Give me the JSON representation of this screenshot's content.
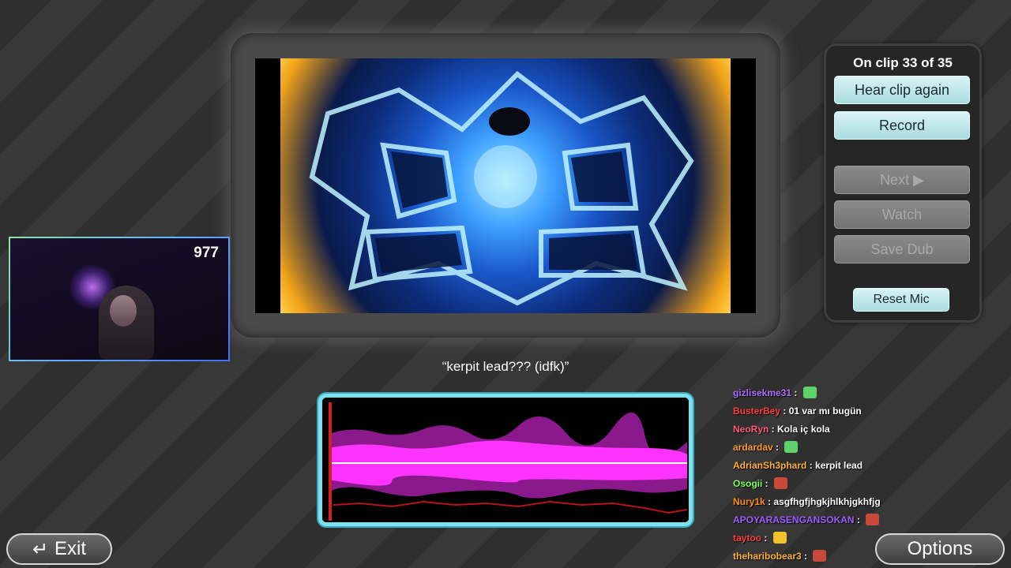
{
  "panel": {
    "clip_status": "On clip 33 of 35",
    "hear_clip_again": "Hear clip again",
    "record": "Record",
    "next": "Next ▶",
    "watch": "Watch",
    "save_dub": "Save Dub",
    "reset_mic": "Reset Mic"
  },
  "webcam": {
    "count": "977"
  },
  "subtitle": "“kerpit lead??? (idfk)”",
  "chat": [
    {
      "user": "gizlisekme31",
      "color": "#b06cff",
      "message": "",
      "emote": "frog"
    },
    {
      "user": "BusterBey",
      "color": "#ff3b3b",
      "message": "01 var mı bugün",
      "emote": ""
    },
    {
      "user": "NeoRyn",
      "color": "#ff5a7a",
      "message": "Kola iç kola",
      "emote": ""
    },
    {
      "user": "ardardav",
      "color": "#ff9a2e",
      "message": "",
      "emote": "frog"
    },
    {
      "user": "AdrianSh3phard",
      "color": "#ffb13b",
      "message": "kerpit lead",
      "emote": ""
    },
    {
      "user": "Osogii",
      "color": "#7cff5a",
      "message": "",
      "emote": "face"
    },
    {
      "user": "Nury1k",
      "color": "#ff8c1a",
      "message": "asgfhgfjhgkjhlkhjgkhfjg",
      "emote": ""
    },
    {
      "user": "APOYARASENGANSOKAN",
      "color": "#a15cff",
      "message": "",
      "emote": "face"
    },
    {
      "user": "taytoo",
      "color": "#ff3b3b",
      "message": "",
      "emote": "cool"
    },
    {
      "user": "theharibobear3",
      "color": "#ffb13b",
      "message": "",
      "emote": "face"
    }
  ],
  "buttons": {
    "exit": "Exit",
    "options": "Options"
  },
  "icons": {
    "exit": "return-arrow-icon"
  }
}
